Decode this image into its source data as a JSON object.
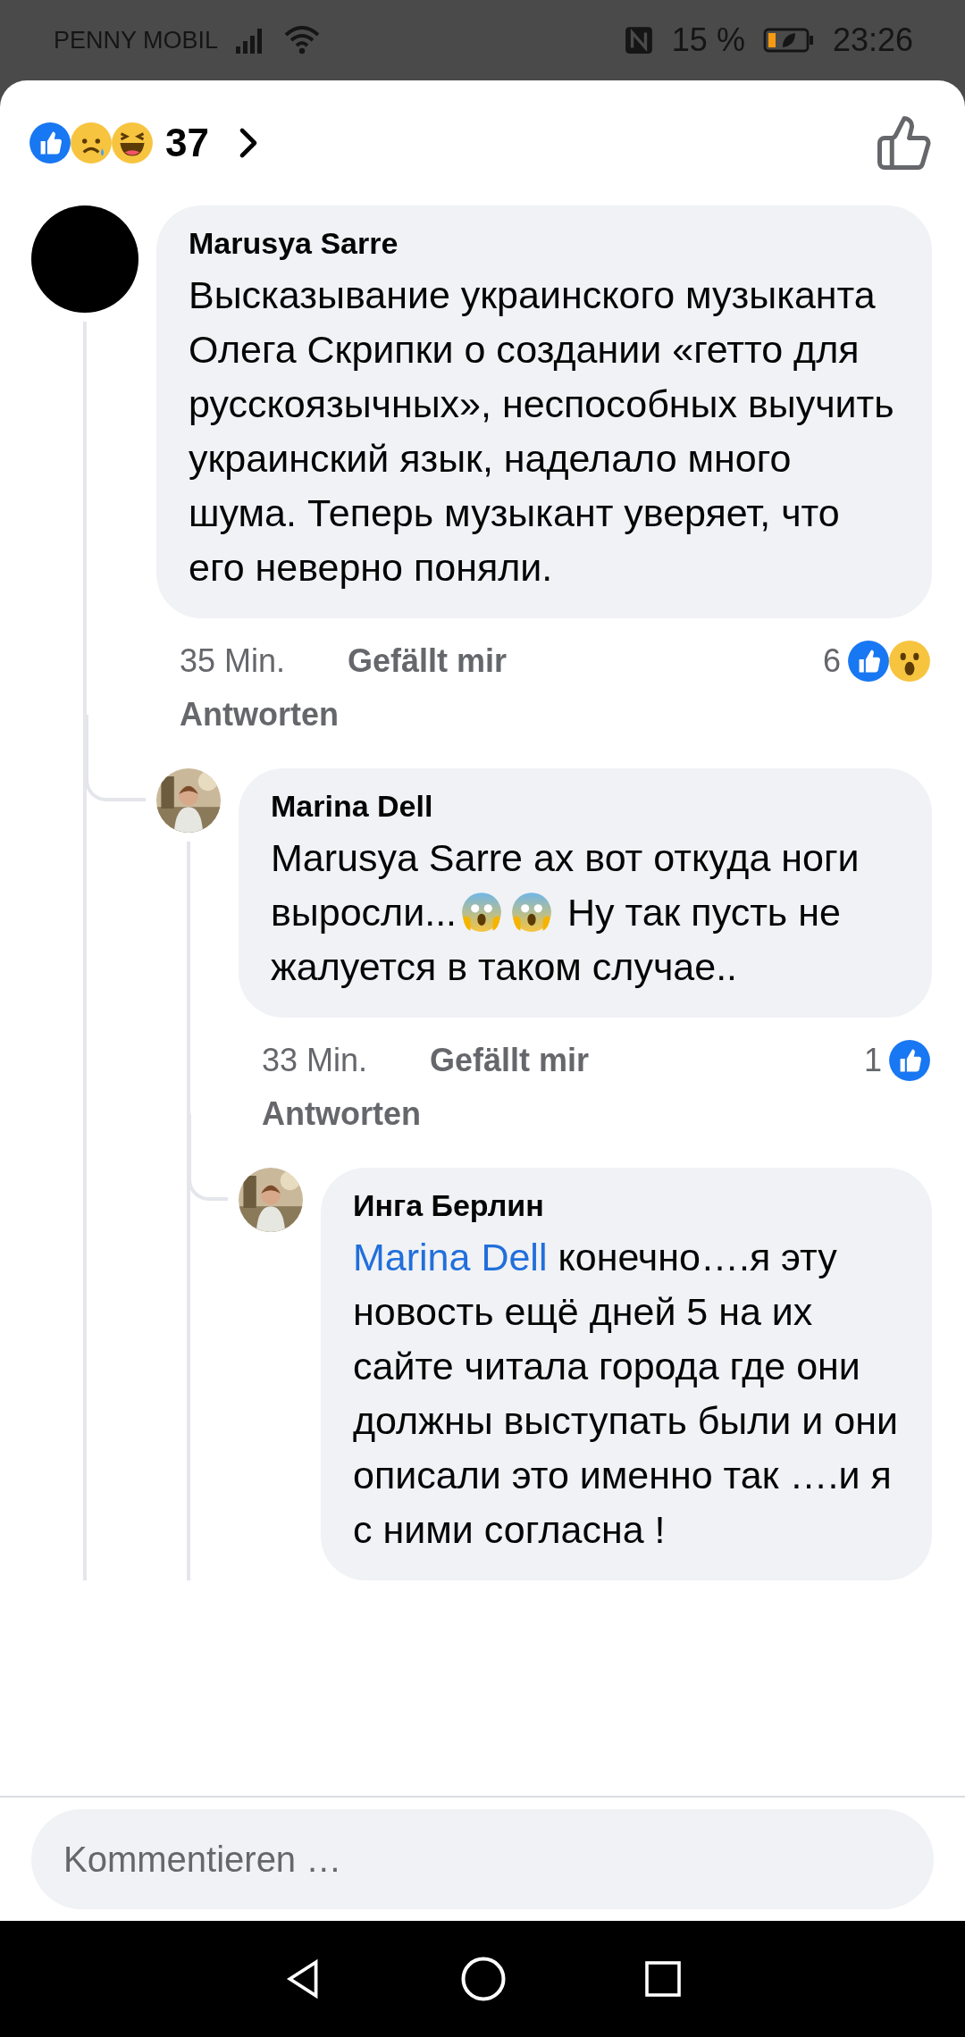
{
  "status_bar": {
    "carrier": "PENNY MOBIL",
    "battery": "15 %",
    "time": "23:26"
  },
  "reactions_header": {
    "reactions": [
      {
        "kind": "like"
      },
      {
        "kind": "sad"
      },
      {
        "kind": "haha"
      }
    ],
    "count": "37"
  },
  "comments": [
    {
      "author": "Marusya Sarre",
      "avatar": {
        "kind": "hidden"
      },
      "segments": [
        {
          "kind": "text",
          "text": "Высказывание украинского музыканта Олега Скрипки о создании «гетто для русскоязычных», неспособных выучить украинский язык, наделало много шума. Теперь музыкант уверяет, что его неверно поняли."
        }
      ],
      "time": "35 Min.",
      "like_label": "Gefällt mir",
      "reply_label": "Antworten",
      "reaction_count": "6",
      "reactions": [
        {
          "kind": "like"
        },
        {
          "kind": "wow"
        }
      ],
      "replies": [
        {
          "author": "Marina Dell",
          "avatar": {
            "kind": "picture"
          },
          "segments": [
            {
              "kind": "text",
              "text": "Marusya Sarre ах вот откуда ноги выросли..."
            },
            {
              "kind": "emoji"
            },
            {
              "kind": "emoji"
            },
            {
              "kind": "text",
              "text": "Ну так пусть не жалуется в таком случае.."
            }
          ],
          "time": "33 Min.",
          "like_label": "Gefällt mir",
          "reply_label": "Antworten",
          "reaction_count": "1",
          "reactions": [
            {
              "kind": "like"
            }
          ],
          "replies": [
            {
              "author": "Инга Берлин",
              "avatar": {
                "kind": "picture"
              },
              "segments": [
                {
                  "kind": "mention",
                  "text": "Marina Dell"
                },
                {
                  "kind": "text",
                  "text": "конечно….я эту новость ещё дней 5 на их сайте читала города где они должны выступать были и они описали это именно так ….и я с ними согласна !"
                }
              ]
            }
          ]
        }
      ]
    }
  ],
  "composer": {
    "placeholder": "Kommentieren …"
  }
}
